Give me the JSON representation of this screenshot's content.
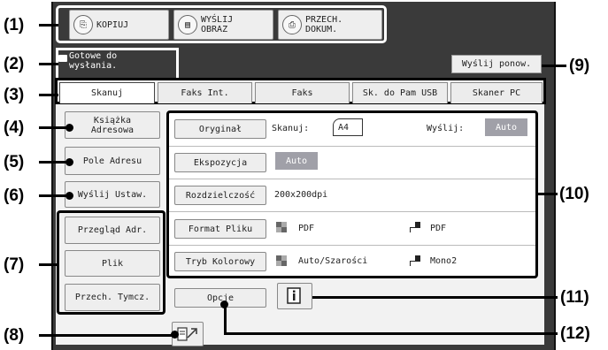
{
  "callouts": [
    "(1)",
    "(2)",
    "(3)",
    "(4)",
    "(5)",
    "(6)",
    "(7)",
    "(8)",
    "(9)",
    "(10)",
    "(11)",
    "(12)"
  ],
  "mode_buttons": [
    {
      "label_line1": "KOPIUJ",
      "label_line2": "",
      "icon": "copy-icon"
    },
    {
      "label_line1": "WYŚLIJ",
      "label_line2": "OBRAZ",
      "icon": "send-image-icon"
    },
    {
      "label_line1": "PRZECH.",
      "label_line2": "DOKUM.",
      "icon": "document-filing-icon"
    }
  ],
  "status": {
    "line1": "Gotowe do",
    "line2": "wysłania.",
    "icon": "mail-icon"
  },
  "resend_label": "Wyślij ponow.",
  "tabs": [
    "Skanuj",
    "Faks Int.",
    "Faks",
    "Sk. do Pam USB",
    "Skaner PC"
  ],
  "active_tab": "Skanuj",
  "side": {
    "address_book_line1": "Książka",
    "address_book_line2": "Adresowa",
    "address_entry": "Pole Adresu",
    "send_settings": "Wyślij Ustaw.",
    "address_review": "Przegląd Adr.",
    "file": "Plik",
    "quick_file": "Przech. Tymcz."
  },
  "settings": {
    "original": {
      "label": "Oryginał",
      "scan_label": "Skanuj:",
      "scan_size": "A4",
      "send_label": "Wyślij:",
      "send_value": "Auto"
    },
    "exposure": {
      "label": "Ekspozycja",
      "value": "Auto"
    },
    "resolution": {
      "label": "Rozdzielczość",
      "value": "200x200dpi"
    },
    "file_format": {
      "label": "Format Pliku",
      "color_value": "PDF",
      "mono_value": "PDF"
    },
    "color_mode": {
      "label": "Tryb Kolorowy",
      "color_value": "Auto/Szarości",
      "mono_value": "Mono2"
    }
  },
  "options_label": "Opcje",
  "info_icon": "info-icon",
  "destination_icon": "address-entry-icon"
}
